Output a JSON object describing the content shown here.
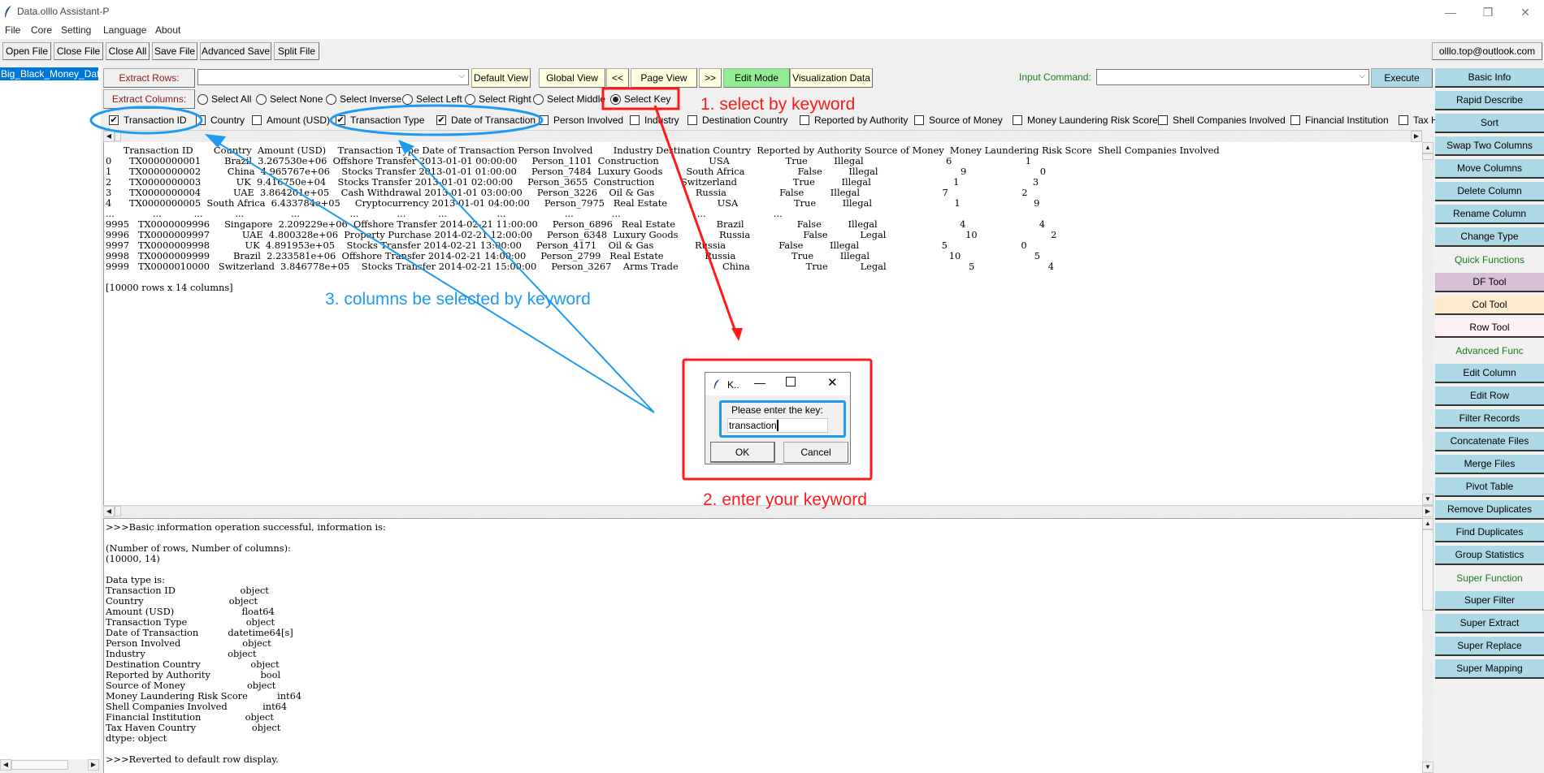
{
  "window": {
    "title": "Data.olllo Assistant-P",
    "controls": [
      "—",
      "❐",
      "✕"
    ]
  },
  "menu": [
    "File",
    "Core",
    "Setting",
    "Language",
    "About"
  ],
  "toolbar": {
    "buttons": [
      "Open File",
      "Close File",
      "Close All",
      "Save File",
      "Advanced Save",
      "Split File"
    ],
    "email": "olllo.top@outlook.com"
  },
  "file_list": {
    "items": [
      "Big_Black_Money_Data"
    ]
  },
  "extract": {
    "rows_label": "Extract Rows:",
    "rows_value": "",
    "columns_label": "Extract Columns:"
  },
  "view_buttons": {
    "default_view": "Default View",
    "global_view": "Global View",
    "prev": "<<",
    "page_view": "Page View",
    "next": ">>",
    "edit_mode": "Edit Mode",
    "visualization": "Visualization Data"
  },
  "command": {
    "label": "Input Command:",
    "value": "",
    "execute": "Execute"
  },
  "select_modes": {
    "options": [
      "Select All",
      "Select None",
      "Select Inverse",
      "Select Left",
      "Select Right",
      "Select Middle",
      "Select Key"
    ],
    "selected": "Select Key"
  },
  "columns": [
    {
      "name": "Transaction ID",
      "checked": true
    },
    {
      "name": "Country",
      "checked": false
    },
    {
      "name": "Amount (USD)",
      "checked": false
    },
    {
      "name": "Transaction Type",
      "checked": true
    },
    {
      "name": "Date of Transaction",
      "checked": true
    },
    {
      "name": "Person Involved",
      "checked": false
    },
    {
      "name": "Industry",
      "checked": false
    },
    {
      "name": "Destination Country",
      "checked": false
    },
    {
      "name": "Reported by Authority",
      "checked": false
    },
    {
      "name": "Source of Money",
      "checked": false
    },
    {
      "name": "Money Laundering Risk Score",
      "checked": false
    },
    {
      "name": "Shell Companies Involved",
      "checked": false
    },
    {
      "name": "Financial Institution",
      "checked": false
    },
    {
      "name": "Tax H",
      "checked": false
    }
  ],
  "table_view": {
    "header": "      Transaction ID       Country  Amount (USD)    Transaction Type Date of Transaction Person Involved       Industry Destination Country  Reported by Authority Source of Money  Money Laundering Risk Score  Shell Companies Involved",
    "rows": [
      "0      TX0000000001        Brazil  3.267530e+06  Offshore Transfer 2013-01-01 00:00:00     Person_1101  Construction                 USA                   True         Illegal                            6                         1",
      "1      TX0000000002         China  4.965767e+06    Stocks Transfer 2013-01-01 01:00:00     Person_7484  Luxury Goods        South Africa                  False         Illegal                            9                         0",
      "2      TX0000000003            UK  9.416750e+04    Stocks Transfer 2013-01-01 02:00:00     Person_3655  Construction         Switzerland                   True         Illegal                            1                         3",
      "3      TX0000000004           UAE  3.864201e+05    Cash Withdrawal 2013-01-01 03:00:00     Person_3226    Oil & Gas              Russia                  False         Illegal                            7                         2",
      "4      TX0000000005  South Africa  6.433784e+05     Cryptocurrency 2013-01-01 04:00:00     Person_7975   Real Estate                 USA                   True         Illegal                            1                         9",
      "...             ...           ...           ...                ...                 ...             ...           ...                 ...                    ...             ...                          ...                       ...",
      "9995   TX0000009996     Singapore  2.209229e+06  Offshore Transfer 2014-02-21 11:00:00     Person_6896   Real Estate              Brazil                  False         Illegal                            4                         4",
      "9996   TX0000009997           UAE  4.800328e+06  Property Purchase 2014-02-21 12:00:00     Person_6348  Luxury Goods              Russia                  False           Legal                           10                         2",
      "9997   TX0000009998            UK  4.891953e+05    Stocks Transfer 2014-02-21 13:00:00     Person_4171    Oil & Gas              Russia                  False         Illegal                            5                         0",
      "9998   TX0000009999        Brazil  2.233581e+06  Offshore Transfer 2014-02-21 14:00:00     Person_2799   Real Estate              Russia                   True         Illegal                           10                         5",
      "9999   TX0000010000   Switzerland  3.846778e+05    Stocks Transfer 2014-02-21 15:00:00     Person_3267    Arms Trade               China                   True           Legal                            5                         4"
    ],
    "summary": "[10000 rows x 14 columns]"
  },
  "console": {
    "lines": [
      ">>>Basic information operation successful, information is:",
      "",
      "(Number of rows, Number of columns):",
      "(10000, 14)",
      "",
      "Data type is:",
      "Transaction ID                      object",
      "Country                             object",
      "Amount (USD)                       float64",
      "Transaction Type                    object",
      "Date of Transaction          datetime64[s]",
      "Person Involved                     object",
      "Industry                            object",
      "Destination Country                 object",
      "Reported by Authority                 bool",
      "Source of Money                     object",
      "Money Laundering Risk Score          int64",
      "Shell Companies Involved            int64",
      "Financial Institution               object",
      "Tax Haven Country                   object",
      "dtype: object",
      "",
      ">>>Reverted to default row display."
    ]
  },
  "right_panel": [
    {
      "type": "button",
      "label": "Basic Info",
      "color": "#add8e6"
    },
    {
      "type": "button",
      "label": "Rapid Describe",
      "color": "#add8e6"
    },
    {
      "type": "button",
      "label": "Sort",
      "color": "#add8e6"
    },
    {
      "type": "button",
      "label": "Swap Two Columns",
      "color": "#add8e6"
    },
    {
      "type": "button",
      "label": "Move Columns",
      "color": "#add8e6"
    },
    {
      "type": "button",
      "label": "Delete Column",
      "color": "#add8e6"
    },
    {
      "type": "button",
      "label": "Rename Column",
      "color": "#add8e6"
    },
    {
      "type": "button",
      "label": "Change Type",
      "color": "#add8e6"
    },
    {
      "type": "label",
      "label": "Quick Functions"
    },
    {
      "type": "button",
      "label": "DF Tool",
      "color": "#d8bfd8"
    },
    {
      "type": "button",
      "label": "Col Tool",
      "color": "#ffebcd"
    },
    {
      "type": "button",
      "label": "Row Tool",
      "color": "#fff0f5"
    },
    {
      "type": "label",
      "label": "Advanced Func"
    },
    {
      "type": "button",
      "label": "Edit Column",
      "color": "#add8e6"
    },
    {
      "type": "button",
      "label": "Edit Row",
      "color": "#add8e6"
    },
    {
      "type": "button",
      "label": "Filter Records",
      "color": "#add8e6"
    },
    {
      "type": "button",
      "label": "Concatenate Files",
      "color": "#add8e6"
    },
    {
      "type": "button",
      "label": "Merge Files",
      "color": "#add8e6"
    },
    {
      "type": "button",
      "label": "Pivot Table",
      "color": "#add8e6"
    },
    {
      "type": "button",
      "label": "Remove Duplicates",
      "color": "#add8e6"
    },
    {
      "type": "button",
      "label": "Find Duplicates",
      "color": "#add8e6"
    },
    {
      "type": "button",
      "label": "Group Statistics",
      "color": "#add8e6"
    },
    {
      "type": "label",
      "label": "Super Function"
    },
    {
      "type": "button",
      "label": "Super Filter",
      "color": "#add8e6"
    },
    {
      "type": "button",
      "label": "Super Extract",
      "color": "#add8e6"
    },
    {
      "type": "button",
      "label": "Super Replace",
      "color": "#add8e6"
    },
    {
      "type": "button",
      "label": "Super Mapping",
      "color": "#add8e6"
    }
  ],
  "dialog": {
    "title": "K..",
    "prompt": "Please enter the key:",
    "value": "transaction",
    "ok": "OK",
    "cancel": "Cancel"
  },
  "annotations": {
    "step1": "1. select by keyword",
    "step2": "2. enter your keyword",
    "step3": "3. columns be selected by keyword",
    "red": "#ff1a1a",
    "blue": "#1e9bf0"
  }
}
